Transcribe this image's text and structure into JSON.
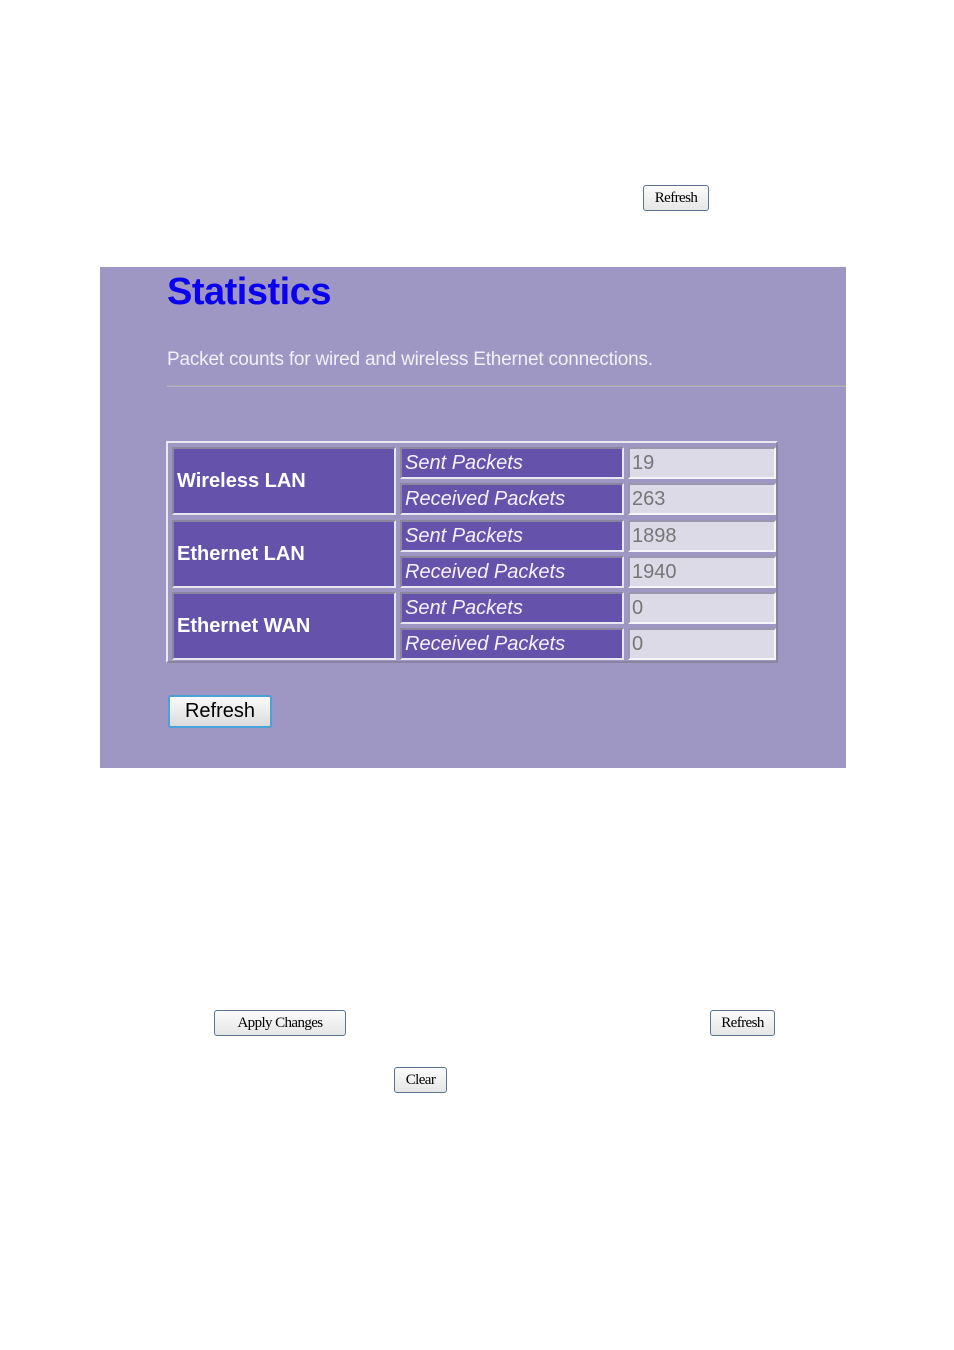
{
  "document": {
    "buttons": {
      "refresh_top": "Refresh",
      "apply_changes": "Apply Changes",
      "refresh_bottom": "Refresh",
      "clear": "Clear"
    }
  },
  "panel": {
    "title": "Statistics",
    "description": "Packet counts for wired and wireless Ethernet connections.",
    "groups": [
      {
        "name": "Wireless LAN",
        "rows": [
          {
            "label": "Sent Packets",
            "value": "19"
          },
          {
            "label": "Received Packets",
            "value": "263"
          }
        ]
      },
      {
        "name": "Ethernet LAN",
        "rows": [
          {
            "label": "Sent Packets",
            "value": "1898"
          },
          {
            "label": "Received Packets",
            "value": "1940"
          }
        ]
      },
      {
        "name": "Ethernet WAN",
        "rows": [
          {
            "label": "Sent Packets",
            "value": "0"
          },
          {
            "label": "Received Packets",
            "value": "0"
          }
        ]
      }
    ],
    "refresh_label": "Refresh"
  },
  "colors": {
    "panel_bg": "#9e96c3",
    "title": "#0a00f0",
    "cell_bg": "#6552ab",
    "value_bg": "#dcdae6"
  }
}
